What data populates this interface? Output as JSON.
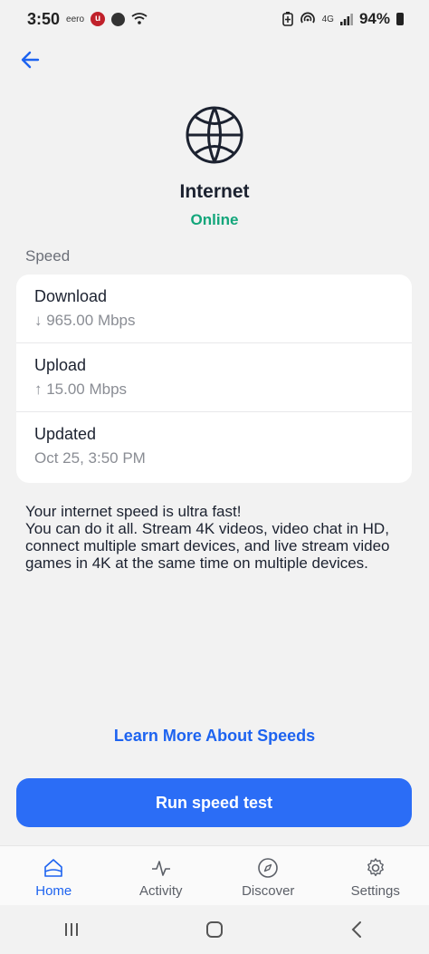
{
  "status_bar": {
    "time": "3:50",
    "carrier_label": "eero",
    "network": "4G",
    "battery": "94%"
  },
  "header": {
    "title": "Internet",
    "status": "Online"
  },
  "speed": {
    "section_label": "Speed",
    "rows": [
      {
        "label": "Download",
        "value": "↓ 965.00 Mbps"
      },
      {
        "label": "Upload",
        "value": "↑ 15.00 Mbps"
      },
      {
        "label": "Updated",
        "value": "Oct 25, 3:50 PM"
      }
    ]
  },
  "description": {
    "headline": "Your internet speed is ultra fast!",
    "body": "You can do it all. Stream 4K videos, video chat in HD, connect multiple smart devices, and live stream video games in 4K at the same time on multiple devices."
  },
  "actions": {
    "learn_more": "Learn More About Speeds",
    "run_test": "Run speed test"
  },
  "tabs": [
    {
      "label": "Home",
      "icon": "home-icon",
      "active": true
    },
    {
      "label": "Activity",
      "icon": "activity-icon",
      "active": false
    },
    {
      "label": "Discover",
      "icon": "compass-icon",
      "active": false
    },
    {
      "label": "Settings",
      "icon": "gear-icon",
      "active": false
    }
  ],
  "colors": {
    "accent": "#1d63f0",
    "online": "#13a67b",
    "button": "#2b6df6"
  }
}
